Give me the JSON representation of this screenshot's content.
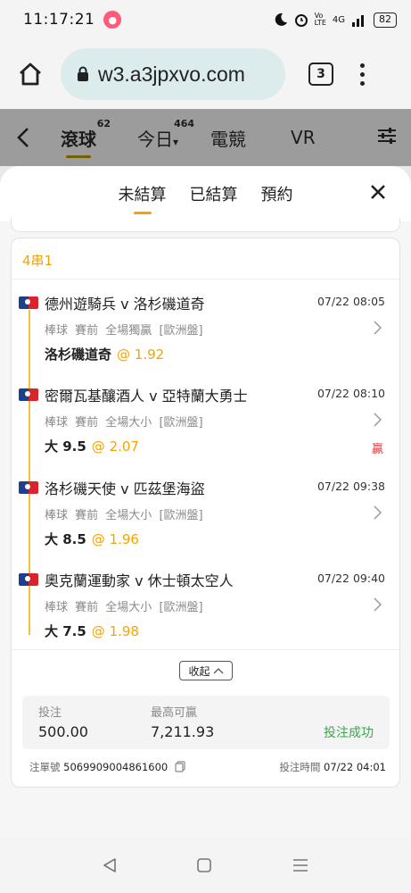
{
  "status_bar": {
    "time": "11:17:21",
    "network": "4G",
    "battery": "82"
  },
  "browser": {
    "url": "w3.a3jpxvo.com",
    "tab_count": "3"
  },
  "app_nav": {
    "items": [
      {
        "label": "滾球",
        "count": "62"
      },
      {
        "label": "今日",
        "count": "464"
      },
      {
        "label": "電競"
      },
      {
        "label": "VR"
      }
    ]
  },
  "sheet": {
    "tabs": [
      "未結算",
      "已結算",
      "預約"
    ],
    "active_tab": "未結算"
  },
  "ticket": {
    "bet_type": "4串1",
    "legs": [
      {
        "match": "德州遊騎兵 v 洛杉磯道奇",
        "date": "07/22 08:05",
        "sport": "棒球 賽前",
        "market": "全場獨贏",
        "odds_type": "[歐洲盤]",
        "selection": "洛杉磯道奇",
        "odds": "@ 1.92",
        "result": ""
      },
      {
        "match": "密爾瓦基釀酒人 v 亞特蘭大勇士",
        "date": "07/22 08:10",
        "sport": "棒球 賽前",
        "market": "全場大小",
        "odds_type": "[歐洲盤]",
        "selection": "大 9.5",
        "odds": "@ 2.07",
        "result": "贏"
      },
      {
        "match": "洛杉磯天使 v 匹茲堡海盜",
        "date": "07/22 09:38",
        "sport": "棒球 賽前",
        "market": "全場大小",
        "odds_type": "[歐洲盤]",
        "selection": "大 8.5",
        "odds": "@ 1.96",
        "result": ""
      },
      {
        "match": "奧克蘭運動家 v 休士頓太空人",
        "date": "07/22 09:40",
        "sport": "棒球 賽前",
        "market": "全場大小",
        "odds_type": "[歐洲盤]",
        "selection": "大 7.5",
        "odds": "@ 1.98",
        "result": ""
      }
    ],
    "collapse_label": "收起",
    "stake_label": "投注",
    "stake_value": "500.00",
    "max_win_label": "最高可贏",
    "max_win_value": "7,211.93",
    "status": "投注成功",
    "ticket_no_label": "注單號",
    "ticket_no": "5069909004861600",
    "bet_time_label": "投注時間",
    "bet_time": "07/22 04:01"
  },
  "colors": {
    "accent": "#f2a500",
    "win": "#e23b3b",
    "success": "#3aa84b"
  }
}
